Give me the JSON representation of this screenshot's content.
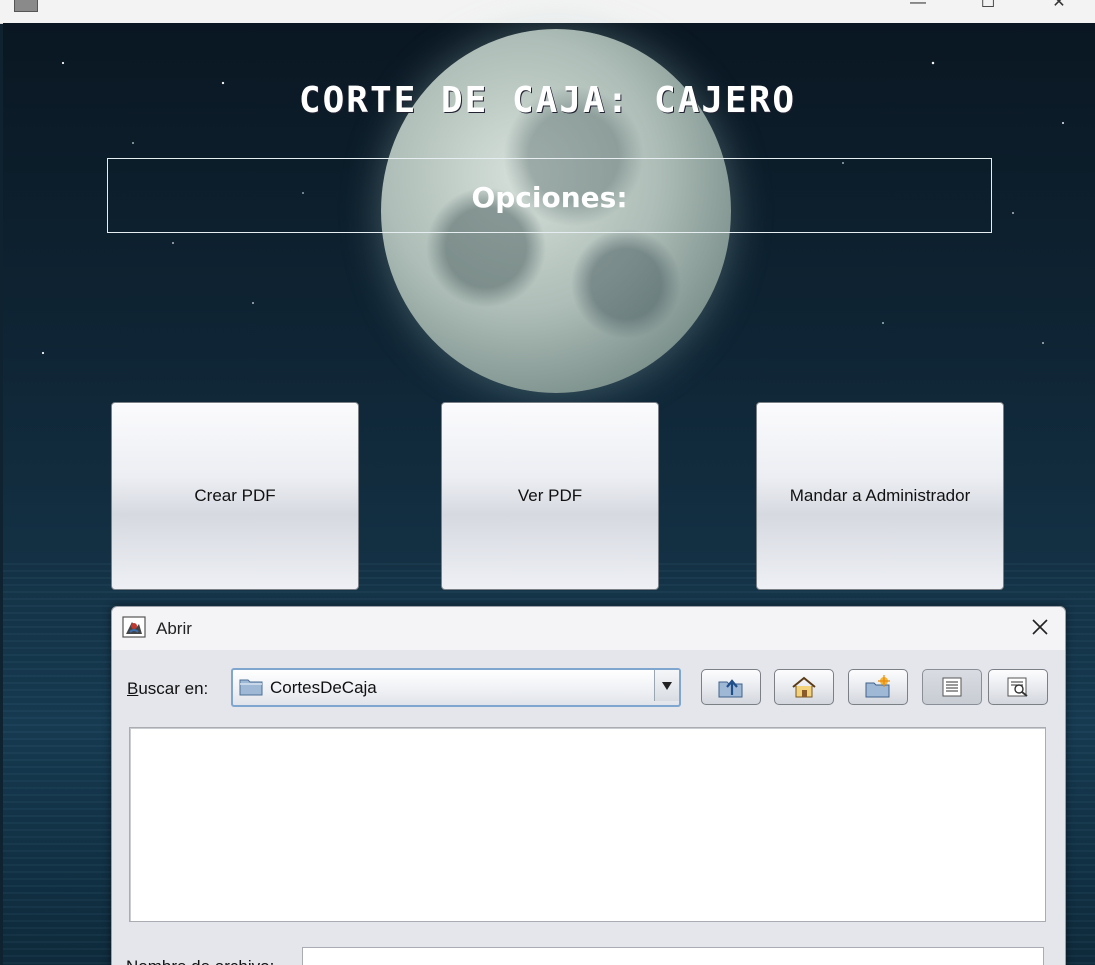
{
  "window": {
    "minimize_glyph": "—",
    "maximize_glyph": "☐",
    "close_glyph": "✕"
  },
  "main": {
    "title": "CORTE DE CAJA: CAJERO",
    "options_label": "Opciones:",
    "buttons": {
      "create_pdf": "Crear PDF",
      "view_pdf": "Ver PDF",
      "send_admin": "Mandar a Administrador"
    }
  },
  "dialog": {
    "title": "Abrir",
    "look_in_label": "Buscar en:",
    "look_in_mnemonic": "B",
    "look_in_rest": "uscar en:",
    "current_folder": "CortesDeCaja",
    "file_name_label": "Nombre de archivo:",
    "file_name_value": "",
    "toolbar_icons": [
      "up-folder-icon",
      "home-icon",
      "new-folder-icon",
      "list-view-icon",
      "details-view-icon"
    ]
  },
  "colors": {
    "combo_border": "#7ea6cf",
    "button_border": "#7b7f86"
  }
}
